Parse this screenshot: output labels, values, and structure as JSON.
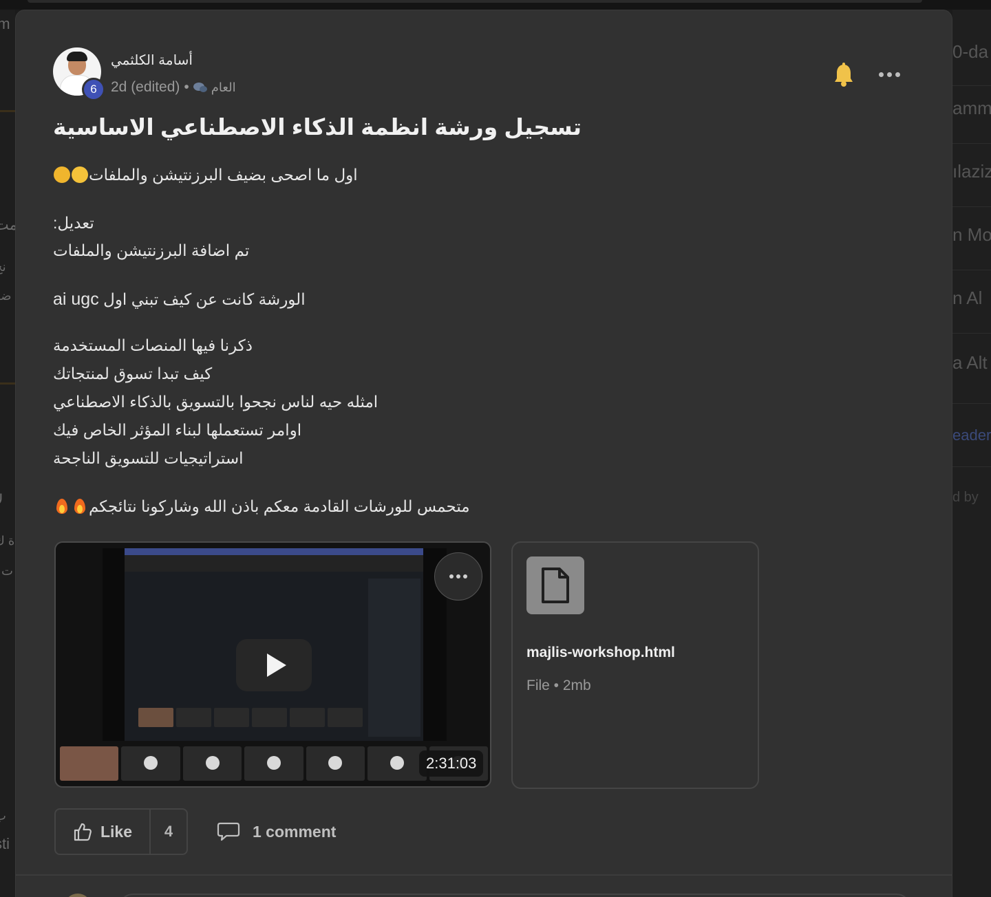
{
  "post": {
    "author": "أسامة الكلثمي",
    "level": "6",
    "time": "2d (edited)",
    "dot": "•",
    "channel": "العام",
    "title": "تسجيل ورشة انظمة الذكاء الاصطناعي الاساسية",
    "lines": [
      "اول ما اصحى بضيف البرزنتيشن والملفات",
      "تعديل:",
      "تم اضافة البرزنتيشن والملفات",
      "الورشة كانت عن كيف تبني اول",
      "ai ugc",
      "ذكرنا فيها المنصات المستخدمة",
      "كيف تبدا تسوق لمنتجاتك",
      "امثله حيه لناس نجحوا بالتسويق بالذكاء الاصطناعي",
      "اوامر تستعملها لبناء المؤثر الخاص فيك",
      "استراتيجيات للتسويق الناجحة",
      "متحمس للورشات القادمة معكم باذن الله وشاركونا نتائجكم"
    ]
  },
  "video": {
    "duration": "2:31:03"
  },
  "attachment": {
    "name": "majlis-workshop.html",
    "meta": "File • 2mb",
    "icon": "file-icon"
  },
  "actions": {
    "like_label": "Like",
    "like_count": "4",
    "comment_label": "1 comment"
  },
  "background": {
    "right_fragments": [
      "0-da",
      "amm",
      "ılaziz",
      "n Mo",
      "n Al",
      "a Alt",
      "eader",
      "d by"
    ],
    "left_fragments": [
      "'m",
      "مت",
      "نخ",
      "ضو",
      "لا",
      "ة ك",
      "ت ا",
      "ب",
      "sti"
    ]
  },
  "colors": {
    "card_bg": "#313131",
    "level_badge": "#3f51b5",
    "bell": "#f0c24a"
  }
}
